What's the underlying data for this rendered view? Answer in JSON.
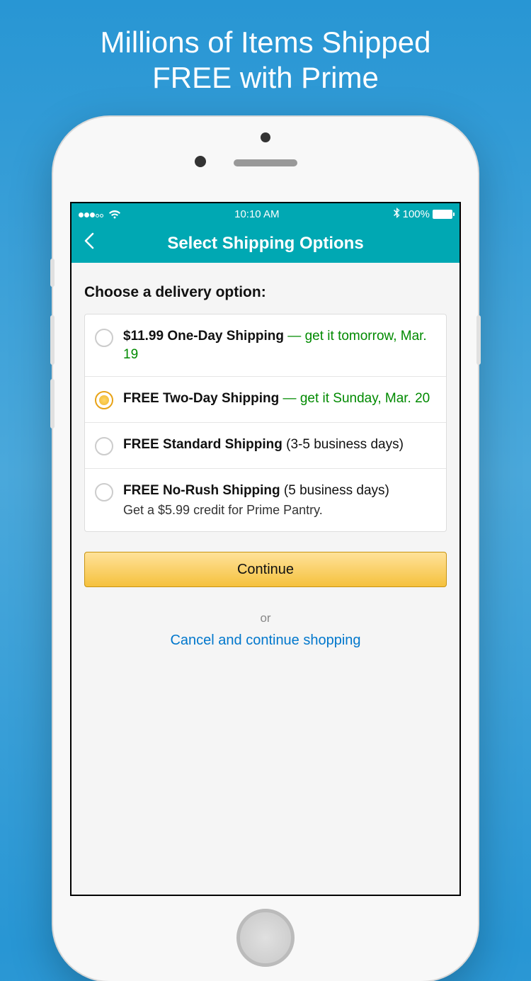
{
  "promo": {
    "line1": "Millions of Items Shipped",
    "line2": "FREE with Prime"
  },
  "status_bar": {
    "time": "10:10 AM",
    "battery_pct": "100%"
  },
  "nav": {
    "title": "Select Shipping Options"
  },
  "page": {
    "heading": "Choose a delivery option:",
    "continue_label": "Continue",
    "or_label": "or",
    "cancel_label": "Cancel and continue shopping"
  },
  "options": [
    {
      "title": "$11.99 One-Day Shipping",
      "dash": " — ",
      "highlight": "get it tomorrow, Mar. 19",
      "note_plain": "",
      "sub": "",
      "selected": false
    },
    {
      "title": "FREE Two-Day Shipping",
      "dash": " — ",
      "highlight": "get it Sunday, Mar. 20",
      "note_plain": "",
      "sub": "",
      "selected": true
    },
    {
      "title": "FREE Standard Shipping",
      "dash": "",
      "highlight": "",
      "note_plain": " (3-5 business days)",
      "sub": "",
      "selected": false
    },
    {
      "title": "FREE No-Rush Shipping",
      "dash": "",
      "highlight": "",
      "note_plain": " (5 business days)",
      "sub": "Get a $5.99 credit for Prime Pantry.",
      "selected": false
    }
  ]
}
